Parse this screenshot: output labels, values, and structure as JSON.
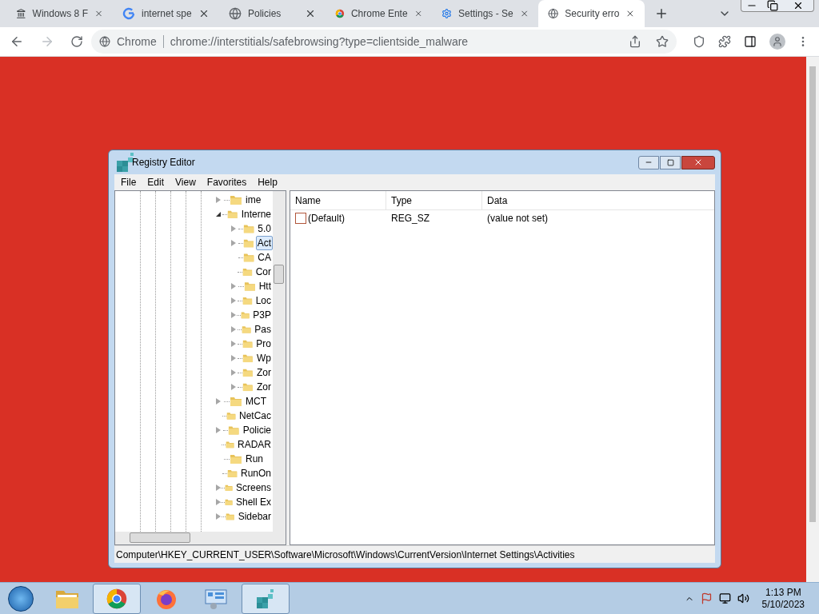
{
  "browser": {
    "tabs": [
      {
        "title": "Windows 8 F",
        "kind": "columns",
        "selected": false
      },
      {
        "title": "internet spe",
        "kind": "google",
        "selected": false
      },
      {
        "title": "Policies",
        "kind": "globe",
        "selected": false
      },
      {
        "title": "Chrome Ente",
        "kind": "chrome",
        "selected": false
      },
      {
        "title": "Settings - Se",
        "kind": "gear",
        "selected": false
      },
      {
        "title": "Security erro",
        "kind": "globe",
        "selected": true
      }
    ],
    "address": {
      "site": "Chrome",
      "url": "chrome://interstitials/safebrowsing?type=clientside_malware"
    }
  },
  "regedit": {
    "title": "Registry Editor",
    "menu": [
      "File",
      "Edit",
      "View",
      "Favorites",
      "Help"
    ],
    "tree": [
      {
        "label": "ime",
        "kind": "collapsed",
        "selected": false
      },
      {
        "label": "Interne",
        "kind": "expanded",
        "selected": false,
        "children": [
          {
            "label": "5.0",
            "kind": "collapsed",
            "selected": false
          },
          {
            "label": "Act",
            "kind": "collapsed",
            "selected": true
          },
          {
            "label": "CA",
            "kind": "leaf",
            "selected": false
          },
          {
            "label": "Cor",
            "kind": "leaf",
            "selected": false
          },
          {
            "label": "Htt",
            "kind": "collapsed",
            "selected": false
          },
          {
            "label": "Loc",
            "kind": "collapsed",
            "selected": false
          },
          {
            "label": "P3P",
            "kind": "collapsed",
            "selected": false
          },
          {
            "label": "Pas",
            "kind": "collapsed",
            "selected": false
          },
          {
            "label": "Pro",
            "kind": "collapsed",
            "selected": false
          },
          {
            "label": "Wp",
            "kind": "collapsed",
            "selected": false
          },
          {
            "label": "Zor",
            "kind": "collapsed",
            "selected": false
          },
          {
            "label": "Zor",
            "kind": "collapsed",
            "selected": false
          }
        ]
      },
      {
        "label": "MCT",
        "kind": "collapsed",
        "selected": false
      },
      {
        "label": "NetCac",
        "kind": "leaf",
        "selected": false
      },
      {
        "label": "Policie",
        "kind": "collapsed",
        "selected": false
      },
      {
        "label": "RADAR",
        "kind": "leaf",
        "selected": false
      },
      {
        "label": "Run",
        "kind": "leaf",
        "selected": false
      },
      {
        "label": "RunOn",
        "kind": "leaf",
        "selected": false
      },
      {
        "label": "Screens",
        "kind": "collapsed",
        "selected": false
      },
      {
        "label": "Shell Ex",
        "kind": "collapsed",
        "selected": false
      },
      {
        "label": "Sidebar",
        "kind": "collapsed",
        "selected": false
      }
    ],
    "columns": [
      "Name",
      "Type",
      "Data"
    ],
    "values": [
      {
        "name": "(Default)",
        "type": "REG_SZ",
        "data": "(value not set)"
      }
    ],
    "status_bar": "Computer\\HKEY_CURRENT_USER\\Software\\Microsoft\\Windows\\CurrentVersion\\Internet Settings\\Activities"
  },
  "taskbar": {
    "apps": [
      {
        "kind": "folder",
        "selected": false
      },
      {
        "kind": "chrome",
        "selected": true
      },
      {
        "kind": "firefox",
        "selected": false
      },
      {
        "kind": "panel",
        "selected": false
      },
      {
        "kind": "regedit",
        "selected": true
      }
    ],
    "time": "1:13 PM",
    "date": "5/10/2023"
  }
}
